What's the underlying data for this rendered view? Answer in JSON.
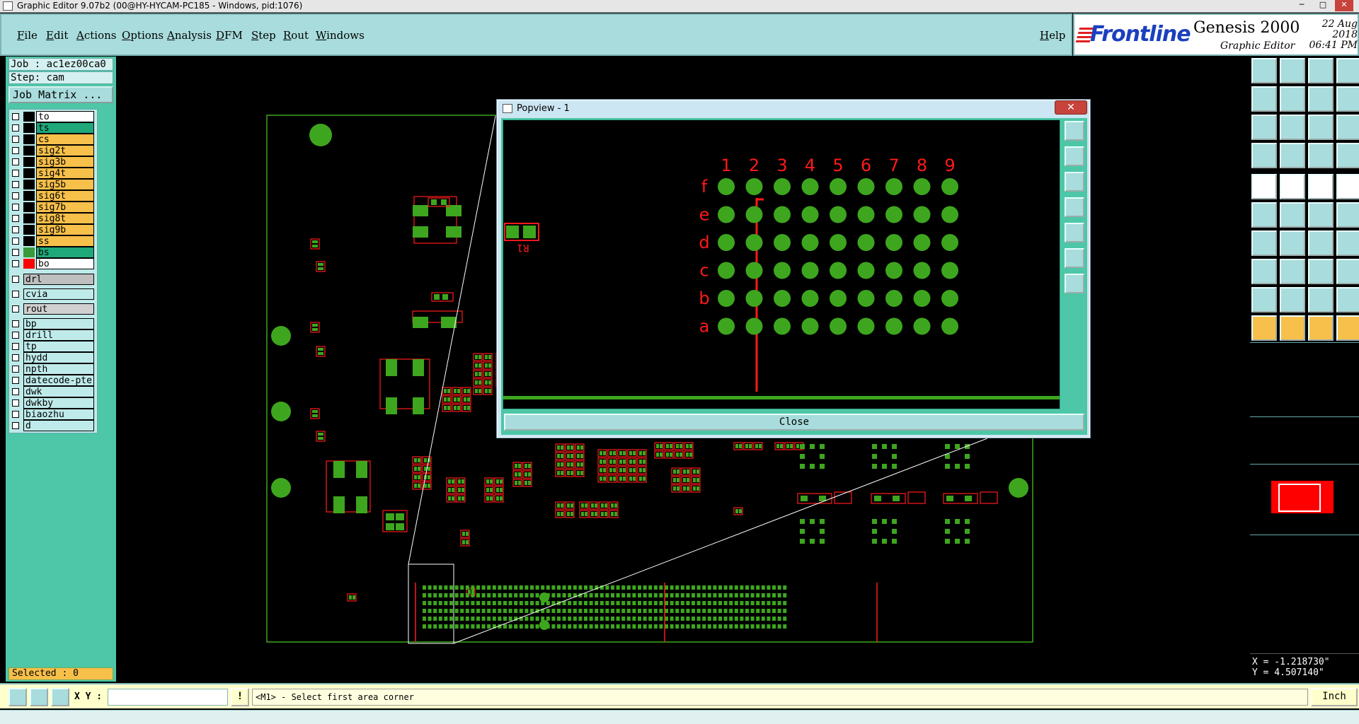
{
  "window": {
    "title": "Graphic Editor 9.07b2 (00@HY-HYCAM-PC185 - Windows, pid:1076)"
  },
  "menu": {
    "items": [
      "File",
      "Edit",
      "Actions",
      "Options",
      "Analysis",
      "DFM",
      "Step",
      "Rout",
      "Windows"
    ],
    "help": "Help"
  },
  "brand": {
    "logo": "Frontline",
    "product": "Genesis 2000",
    "subtitle": "Graphic Editor",
    "date": "22 Aug 2018",
    "time": "06:41 PM"
  },
  "job": {
    "job_label": "Job : ac1ez00ca0",
    "step_label": "Step: cam",
    "matrix_button": "Job Matrix ..."
  },
  "layers": [
    {
      "name": "to",
      "color": "#ffffff",
      "swatch": "#000000"
    },
    {
      "name": "ts",
      "color": "#1fa87a",
      "swatch": "#000000"
    },
    {
      "name": "cs",
      "color": "#f7c04a",
      "swatch": "#000000"
    },
    {
      "name": "sig2t",
      "color": "#f7c04a",
      "swatch": "#000000"
    },
    {
      "name": "sig3b",
      "color": "#f7c04a",
      "swatch": "#000000"
    },
    {
      "name": "sig4t",
      "color": "#f7c04a",
      "swatch": "#000000"
    },
    {
      "name": "sig5b",
      "color": "#f7c04a",
      "swatch": "#000000"
    },
    {
      "name": "sig6t",
      "color": "#f7c04a",
      "swatch": "#000000"
    },
    {
      "name": "sig7b",
      "color": "#f7c04a",
      "swatch": "#000000"
    },
    {
      "name": "sig8t",
      "color": "#f7c04a",
      "swatch": "#000000"
    },
    {
      "name": "sig9b",
      "color": "#f7c04a",
      "swatch": "#000000"
    },
    {
      "name": "ss",
      "color": "#f7c04a",
      "swatch": "#000000"
    },
    {
      "name": "bs",
      "color": "#1fa87a",
      "swatch": "#3a9a3a"
    },
    {
      "name": "bo",
      "color": "#ffffff",
      "swatch": "#ff0000"
    }
  ],
  "layers_drill": [
    {
      "name": "drl",
      "color": "#bfbfbf"
    }
  ],
  "layers_via": [
    {
      "name": "cvia",
      "color": "#bfeaea"
    }
  ],
  "layers_rout": [
    {
      "name": "rout",
      "color": "#d0d0d0"
    }
  ],
  "layers_misc": [
    {
      "name": "bp"
    },
    {
      "name": "drill"
    },
    {
      "name": "tp"
    },
    {
      "name": "hydd"
    },
    {
      "name": "npth"
    },
    {
      "name": "datecode-pte"
    },
    {
      "name": "dwk"
    },
    {
      "name": "dwkby"
    },
    {
      "name": "biaozhu"
    },
    {
      "name": "d"
    }
  ],
  "selected": "Selected : 0",
  "coords": {
    "x": "X = -1.218730\"",
    "y": "Y = 4.507140\""
  },
  "status": {
    "xy_label": "X Y :",
    "xy_value": "",
    "message": "<M1> - Select first area corner",
    "units": "Inch"
  },
  "popup": {
    "title": "Popview - 1",
    "close": "Close",
    "columns": [
      "1",
      "2",
      "3",
      "4",
      "5",
      "6",
      "7",
      "8",
      "9"
    ],
    "rows": [
      "f",
      "e",
      "d",
      "c",
      "b",
      "a"
    ],
    "component_label": "R1"
  },
  "colors": {
    "pad_green": "#3ea61e",
    "silk_red": "#ff1a1a",
    "panel_teal": "#4dc7a7",
    "board_outline": "#3ea61e"
  }
}
